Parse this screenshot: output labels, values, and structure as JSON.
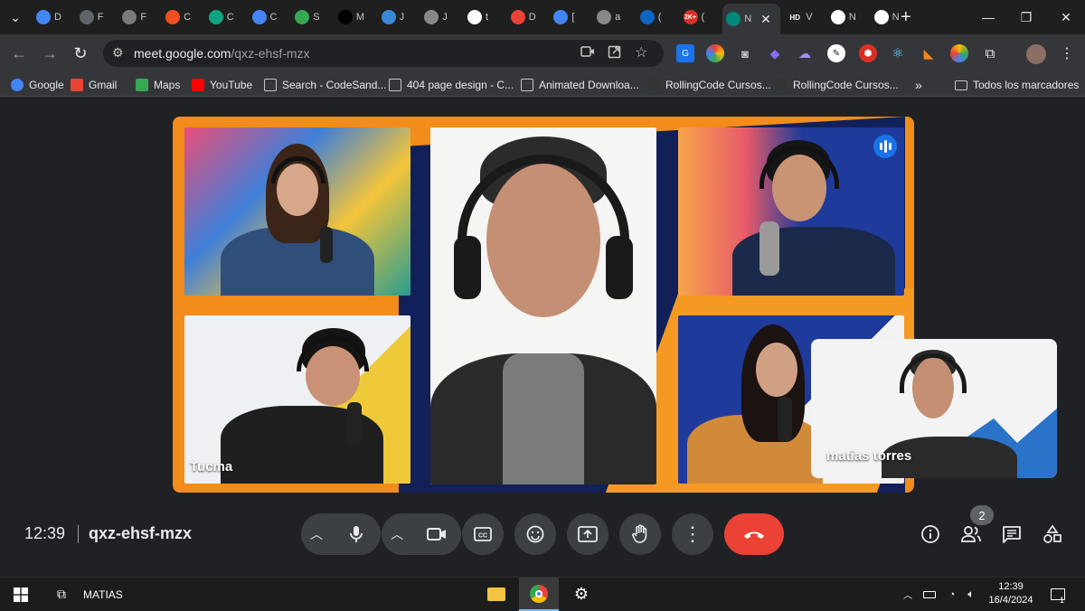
{
  "browser": {
    "tabs": [
      {
        "label": "D",
        "icon": "circle-globe-icon",
        "color": "#4285f4"
      },
      {
        "label": "F",
        "icon": "circle-icon",
        "color": "#5f6368"
      },
      {
        "label": "F",
        "icon": "cart-icon",
        "color": "#7a7a7a"
      },
      {
        "label": "C",
        "icon": "microsoft-icon",
        "color": "#f25022"
      },
      {
        "label": "C",
        "icon": "openai-icon",
        "color": "#10a37f"
      },
      {
        "label": "C",
        "icon": "circle-globe-icon",
        "color": "#4285f4"
      },
      {
        "label": "S",
        "icon": "spiral-icon",
        "color": "#34a853"
      },
      {
        "label": "M",
        "icon": "x-icon",
        "color": "#000000"
      },
      {
        "label": "J",
        "icon": "diamond-icon",
        "color": "#3b8ad9"
      },
      {
        "label": "J",
        "icon": "openai-icon",
        "color": "#888888"
      },
      {
        "label": "t",
        "icon": "google-icon",
        "color": "#ffffff"
      },
      {
        "label": "D",
        "icon": "gmail-icon",
        "color": "#ea4335"
      },
      {
        "label": "[",
        "icon": "docs-icon",
        "color": "#4285f4"
      },
      {
        "label": "a",
        "icon": "openai-icon",
        "color": "#888888"
      },
      {
        "label": "(",
        "icon": "linkedin-icon",
        "color": "#0a66c2"
      },
      {
        "label": "(",
        "icon": "badge-icon",
        "color": "#d93025",
        "badge": "2K+"
      },
      {
        "label": "N",
        "icon": "meet-icon",
        "color": "#00897b",
        "active": true
      },
      {
        "label": "V",
        "icon": "hd-icon",
        "color": "#222222",
        "text": "HD"
      },
      {
        "label": "N",
        "icon": "chrome-icon",
        "color": "#ffffff"
      },
      {
        "label": "N",
        "icon": "chrome-icon",
        "color": "#ffffff"
      }
    ],
    "new_tab": "+",
    "url_host": "meet.google.com",
    "url_path": "/qxz-ehsf-mzx",
    "bookmarks": [
      {
        "label": "Google",
        "icon": "google-icon",
        "color": "#4285f4"
      },
      {
        "label": "Gmail",
        "icon": "gmail-icon",
        "color": "#ea4335"
      },
      {
        "label": "Maps",
        "icon": "maps-pin-icon",
        "color": "#34a853"
      },
      {
        "label": "YouTube",
        "icon": "youtube-icon",
        "color": "#ff0000"
      },
      {
        "label": "Search - CodeSand...",
        "icon": "page-icon"
      },
      {
        "label": "404 page design - C...",
        "icon": "page-icon"
      },
      {
        "label": "Animated Downloa...",
        "icon": "page-icon"
      },
      {
        "label": "RollingCode Cursos...",
        "icon": "rolling-icon",
        "color": "#333333"
      },
      {
        "label": "RollingCode Cursos...",
        "icon": "rolling-icon",
        "color": "#333333"
      }
    ],
    "overflow": "»",
    "all_bookmarks": "Todos los marcadores"
  },
  "meet": {
    "participants": [
      {
        "name": "",
        "tile": "top-left"
      },
      {
        "name": "Tucma",
        "tile": "bottom-left"
      },
      {
        "name": "",
        "tile": "center"
      },
      {
        "name": "",
        "tile": "top-right"
      },
      {
        "name": "",
        "tile": "bottom-right"
      }
    ],
    "self_view_name": "matias torres",
    "time": "12:39",
    "meeting_code": "qxz-ehsf-mzx",
    "participant_count": "2",
    "colors": {
      "end_call": "#ea4335",
      "control_bg": "#3c4043",
      "speaking": "#1a73e8"
    }
  },
  "taskbar": {
    "user": "MATIAS",
    "clock_time": "12:39",
    "clock_date": "16/4/2024",
    "notification_count": "1"
  }
}
